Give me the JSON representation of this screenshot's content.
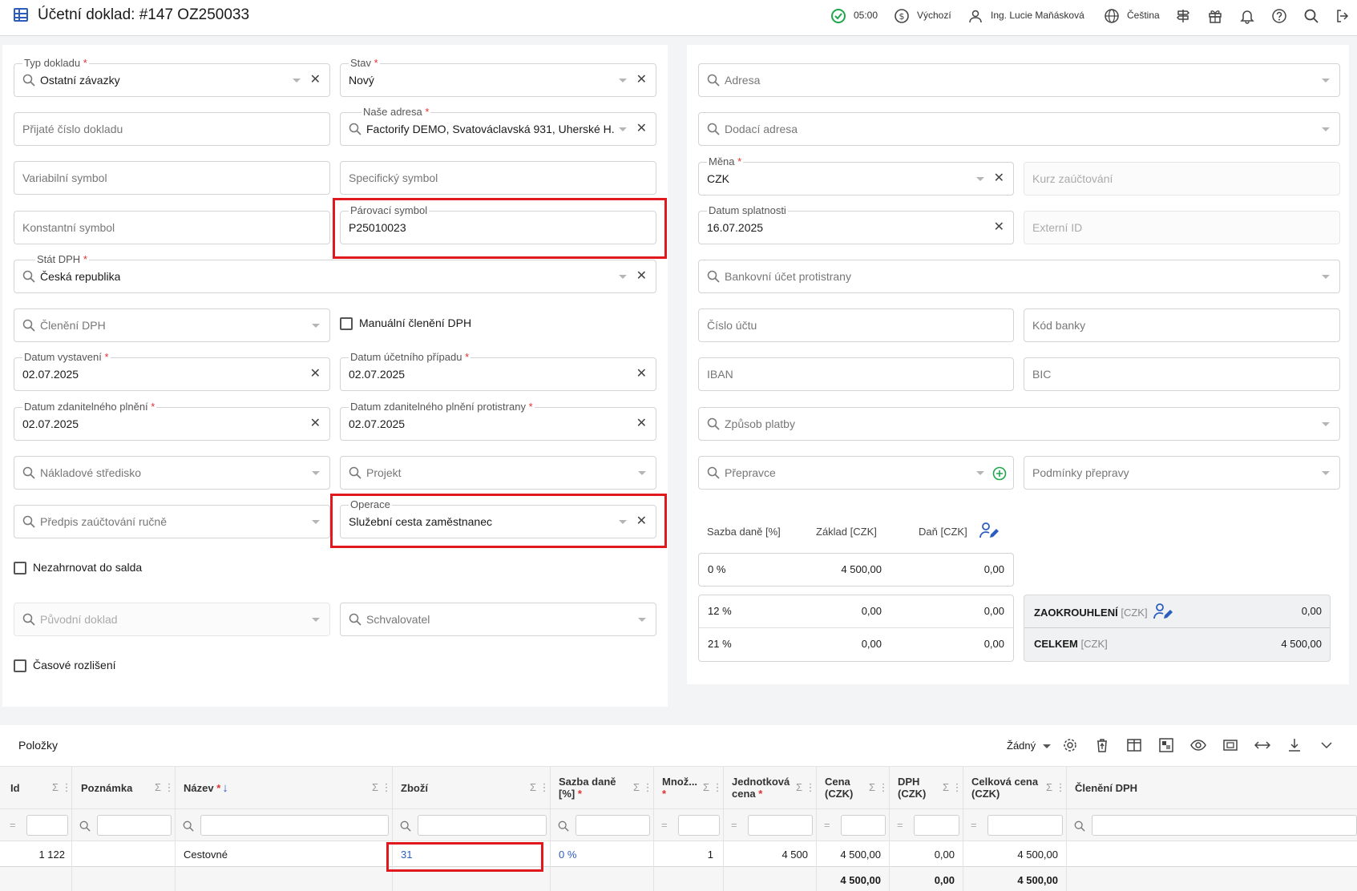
{
  "header": {
    "title": "Účetní doklad: #147 OZ250033",
    "time": "05:00",
    "currency_setting": "Výchozí",
    "user": "Ing. Lucie Maňásková",
    "language": "Čeština",
    "icons": [
      "table-icon",
      "check-circle-icon",
      "dollar-icon",
      "user-icon",
      "globe-icon",
      "signpost-icon",
      "gift-icon",
      "bell-icon",
      "help-icon",
      "search-icon",
      "logout-icon"
    ]
  },
  "left": {
    "typ_dokladu": {
      "label": "Typ dokladu",
      "value": "Ostatní závazky"
    },
    "stav": {
      "label": "Stav",
      "value": "Nový"
    },
    "prijate_cislo": {
      "placeholder": "Přijaté číslo dokladu"
    },
    "nase_adresa": {
      "label": "Naše adresa",
      "value": "Factorify DEMO, Svatováclavská 931, Uherské H..."
    },
    "variabilni": {
      "placeholder": "Variabilní symbol"
    },
    "specificky": {
      "placeholder": "Specifický symbol"
    },
    "konstantni": {
      "placeholder": "Konstantní symbol"
    },
    "parovaci": {
      "label": "Párovací symbol",
      "value": "P25010023"
    },
    "stat_dph": {
      "label": "Stát DPH",
      "value": "Česká republika"
    },
    "cleneni_dph": {
      "placeholder": "Členění DPH"
    },
    "manualni_cleneni": {
      "label": "Manuální členění DPH"
    },
    "datum_vystaveni": {
      "label": "Datum vystavení",
      "value": "02.07.2025"
    },
    "datum_ucetniho": {
      "label": "Datum účetního případu",
      "value": "02.07.2025"
    },
    "datum_zdanitelneho": {
      "label": "Datum zdanitelného plnění",
      "value": "02.07.2025"
    },
    "datum_zdanitelneho_protistrany": {
      "label": "Datum zdanitelného plnění protistrany",
      "value": "02.07.2025"
    },
    "nakladove": {
      "placeholder": "Nákladové středisko"
    },
    "projekt": {
      "placeholder": "Projekt"
    },
    "predpis": {
      "placeholder": "Předpis zaúčtování ručně"
    },
    "operace": {
      "label": "Operace",
      "value": "Služební cesta zaměstnanec"
    },
    "nezahrnovat": {
      "label": "Nezahrnovat do salda"
    },
    "puvodni": {
      "placeholder": "Původní doklad"
    },
    "schvalovatel": {
      "placeholder": "Schvalovatel"
    },
    "casove": {
      "label": "Časové rozlišení"
    }
  },
  "right": {
    "adresa": {
      "placeholder": "Adresa"
    },
    "dodaci": {
      "placeholder": "Dodací adresa"
    },
    "mena": {
      "label": "Měna",
      "value": "CZK"
    },
    "kurz": {
      "placeholder": "Kurz zaúčtování"
    },
    "datum_splatnosti": {
      "label": "Datum splatnosti",
      "value": "16.07.2025"
    },
    "externi": {
      "placeholder": "Externí ID"
    },
    "bankovni": {
      "placeholder": "Bankovní účet protistrany"
    },
    "cislo_uctu": {
      "placeholder": "Číslo účtu"
    },
    "kod_banky": {
      "placeholder": "Kód banky"
    },
    "iban": {
      "placeholder": "IBAN"
    },
    "bic": {
      "placeholder": "BIC"
    },
    "zpusob": {
      "placeholder": "Způsob platby"
    },
    "prepravce": {
      "placeholder": "Přepravce"
    },
    "podminky": {
      "placeholder": "Podmínky přepravy"
    }
  },
  "vat": {
    "headers": [
      "Sazba daně [%]",
      "Základ [CZK]",
      "Daň [CZK]"
    ],
    "rows": [
      {
        "rate": "0 %",
        "base": "4 500,00",
        "tax": "0,00"
      },
      {
        "rate": "12 %",
        "base": "0,00",
        "tax": "0,00"
      },
      {
        "rate": "21 %",
        "base": "0,00",
        "tax": "0,00"
      }
    ],
    "rounding_label": "ZAOKROUHLENÍ",
    "rounding_unit": "[CZK]",
    "rounding_value": "0,00",
    "total_label": "CELKEM",
    "total_unit": "[CZK]",
    "total_value": "4 500,00"
  },
  "items": {
    "title": "Položky",
    "view_select": "Žádný",
    "columns": {
      "id": "Id",
      "poznamka": "Poznámka",
      "nazev": "Název",
      "zbozi": "Zboží",
      "sazba1": "Sazba daně",
      "sazba2": "[%]",
      "mnoz": "Množ...",
      "jedn1": "Jednotková",
      "jedn2": "cena",
      "cena1": "Cena",
      "cena2": "(CZK)",
      "dph1": "DPH",
      "dph2": "(CZK)",
      "celk1": "Celková cena",
      "celk2": "(CZK)",
      "cleneni": "Členění DPH"
    },
    "row": {
      "id": "1 122",
      "poznamka": "",
      "nazev": "Cestovné",
      "zbozi": "31",
      "sazba": "0 %",
      "mnozstvi": "1",
      "jednotkova": "4 500",
      "cena": "4 500,00",
      "dph": "0,00",
      "celkova": "4 500,00",
      "cleneni": ""
    },
    "totals": {
      "cena": "4 500,00",
      "dph": "0,00",
      "celkova": "4 500,00"
    }
  }
}
